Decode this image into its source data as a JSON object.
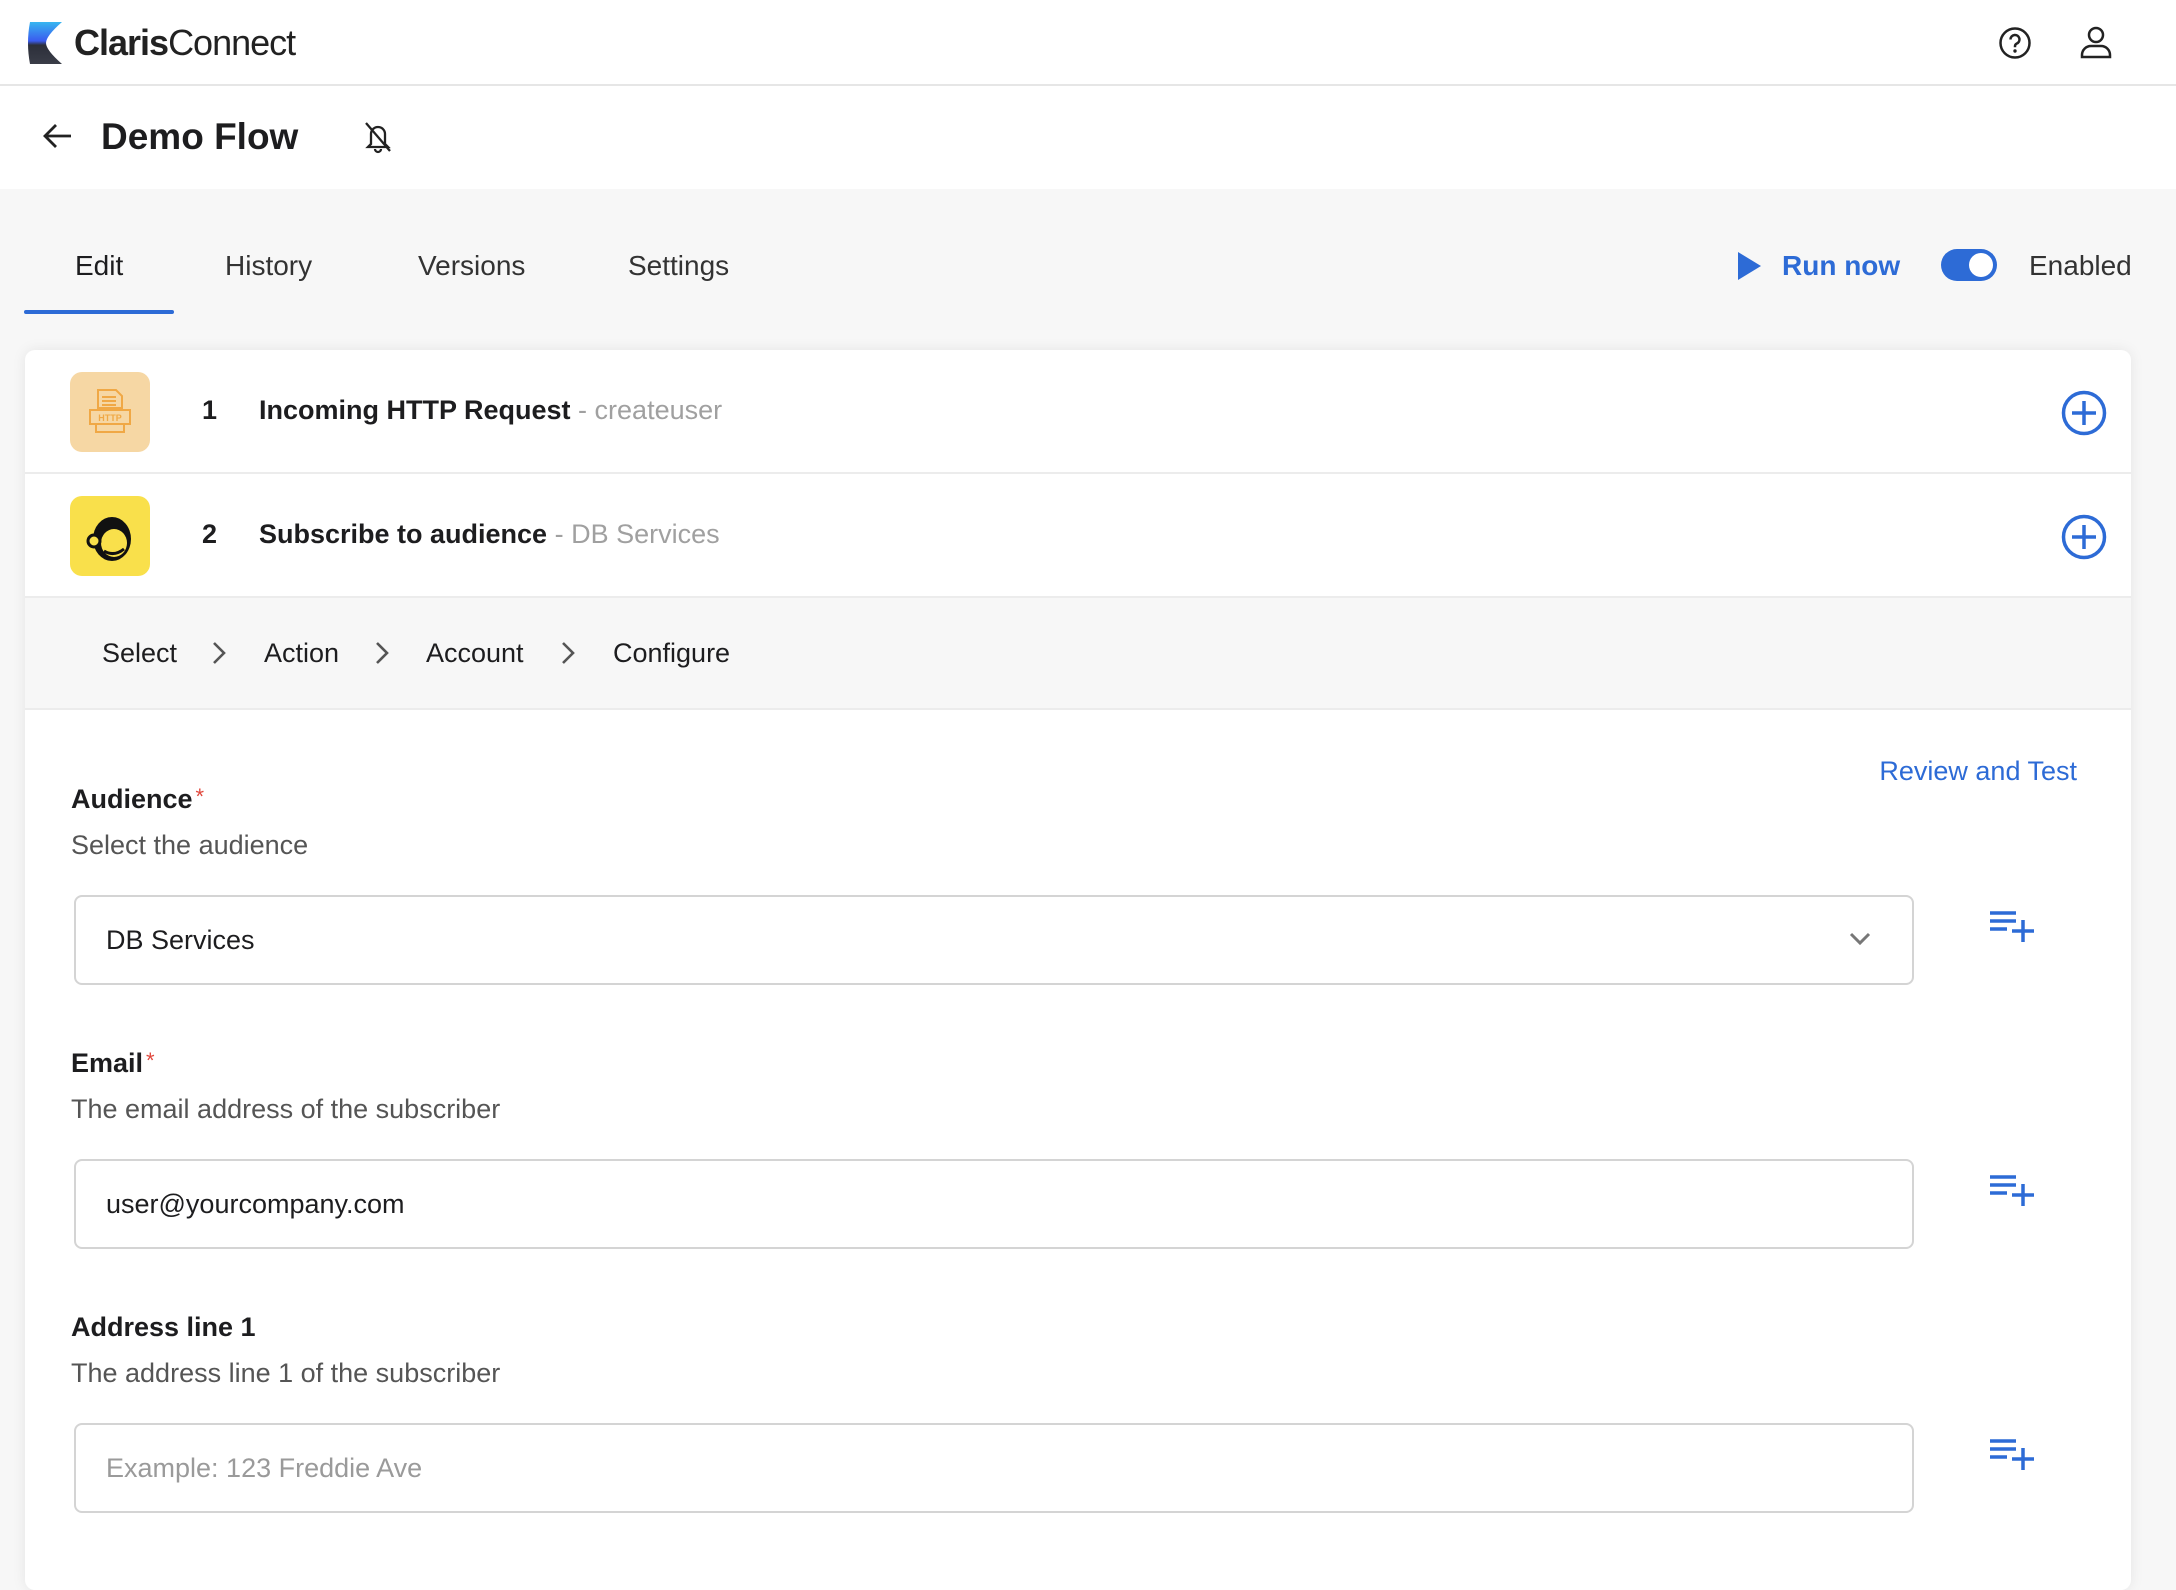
{
  "app": {
    "brand_bold": "Claris",
    "brand_light": "Connect"
  },
  "header": {
    "title": "Demo Flow"
  },
  "tabs": [
    {
      "label": "Edit"
    },
    {
      "label": "History"
    },
    {
      "label": "Versions"
    },
    {
      "label": "Settings"
    }
  ],
  "actions": {
    "run_now": "Run now",
    "enabled_label": "Enabled",
    "enabled": true
  },
  "steps": [
    {
      "number": "1",
      "title": "Incoming HTTP Request",
      "subtitle": "- createuser"
    },
    {
      "number": "2",
      "title": "Subscribe to audience",
      "subtitle": "- DB Services"
    }
  ],
  "breadcrumb": [
    "Select",
    "Action",
    "Account",
    "Configure"
  ],
  "review_link": "Review and Test",
  "fields": [
    {
      "label": "Audience",
      "required": "*",
      "description": "Select the audience",
      "value": "DB Services"
    },
    {
      "label": "Email",
      "required": "*",
      "description": "The email address of the subscriber",
      "value": "user@yourcompany.com"
    },
    {
      "label": "Address line 1",
      "description": "The address line 1 of the subscriber",
      "placeholder": "Example: 123 Freddie Ave"
    }
  ],
  "colors": {
    "accent": "#2d6bd6",
    "http_bg": "#f6d7a4",
    "mailchimp_bg": "#f9e04b"
  }
}
